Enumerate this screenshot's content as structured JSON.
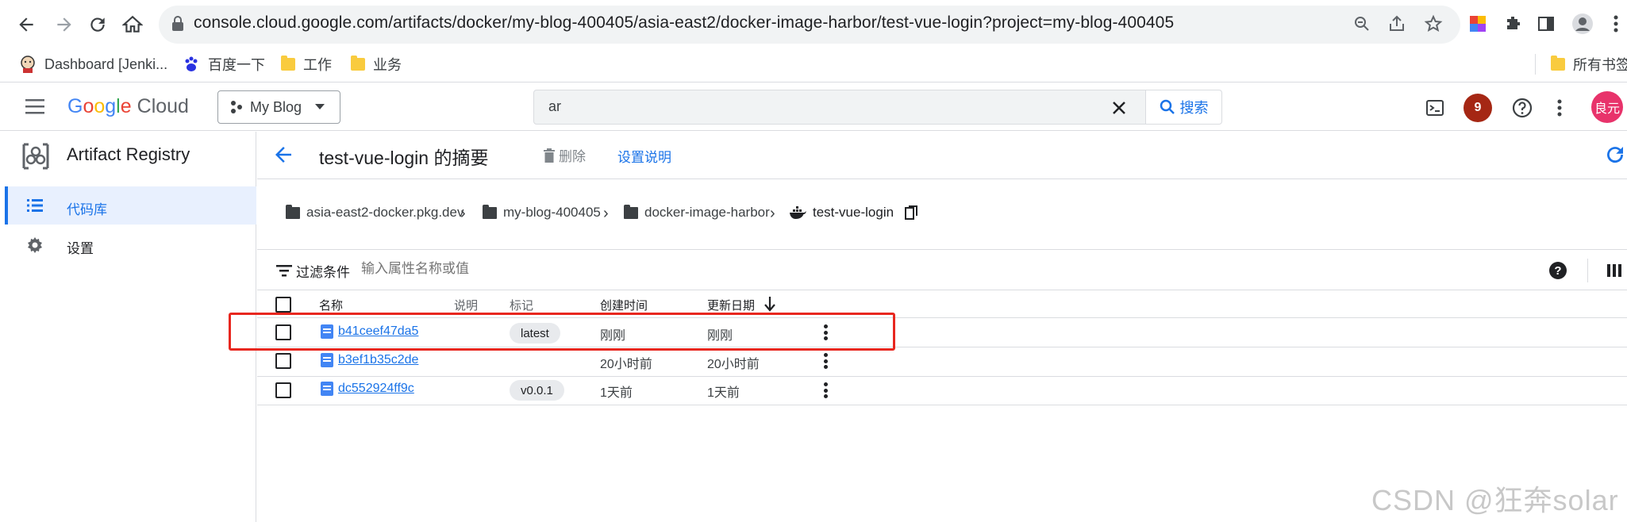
{
  "browser": {
    "url": "console.cloud.google.com/artifacts/docker/my-blog-400405/asia-east2/docker-image-harbor/test-vue-login?project=my-blog-400405"
  },
  "bookmarks": [
    {
      "label": "Dashboard [Jenki..."
    },
    {
      "label": "百度一下"
    },
    {
      "label": "工作"
    },
    {
      "label": "业务"
    },
    {
      "label": "所有书签"
    }
  ],
  "console": {
    "logo": {
      "letters": [
        "G",
        "o",
        "o",
        "g",
        "l",
        "e"
      ],
      "suffix": "Cloud"
    },
    "project": "My Blog",
    "search": {
      "value": "ar",
      "button": "搜索"
    },
    "notification_count": "9",
    "avatar_text": "良元"
  },
  "nav": {
    "product": "Artifact Registry",
    "items": [
      {
        "label": "代码库",
        "selected": true
      },
      {
        "label": "设置",
        "selected": false
      }
    ]
  },
  "header": {
    "title": "test-vue-login 的摘要",
    "delete": "删除",
    "setup": "设置说明"
  },
  "breadcrumb": [
    {
      "label": "asia-east2-docker.pkg.dev"
    },
    {
      "label": "my-blog-400405"
    },
    {
      "label": "docker-image-harbor"
    },
    {
      "label": "test-vue-login"
    }
  ],
  "filter": {
    "label": "过滤条件",
    "placeholder": "输入属性名称或值"
  },
  "table": {
    "columns": {
      "name": "名称",
      "description": "说明",
      "tags": "标记",
      "created": "创建时间",
      "updated": "更新日期"
    },
    "rows": [
      {
        "digest": "b41ceef47da5",
        "tag": "latest",
        "created": "刚刚",
        "updated": "刚刚"
      },
      {
        "digest": "b3ef1b35c2de",
        "tag": "",
        "created": "20小时前",
        "updated": "20小时前"
      },
      {
        "digest": "dc552924ff9c",
        "tag": "v0.0.1",
        "created": "1天前",
        "updated": "1天前"
      }
    ]
  },
  "watermark": "CSDN @狂奔solar",
  "colors": {
    "accent": "#1a73e8",
    "highlight": "#e8271f",
    "avatar": "#e8336b",
    "badge": "#a52714"
  }
}
